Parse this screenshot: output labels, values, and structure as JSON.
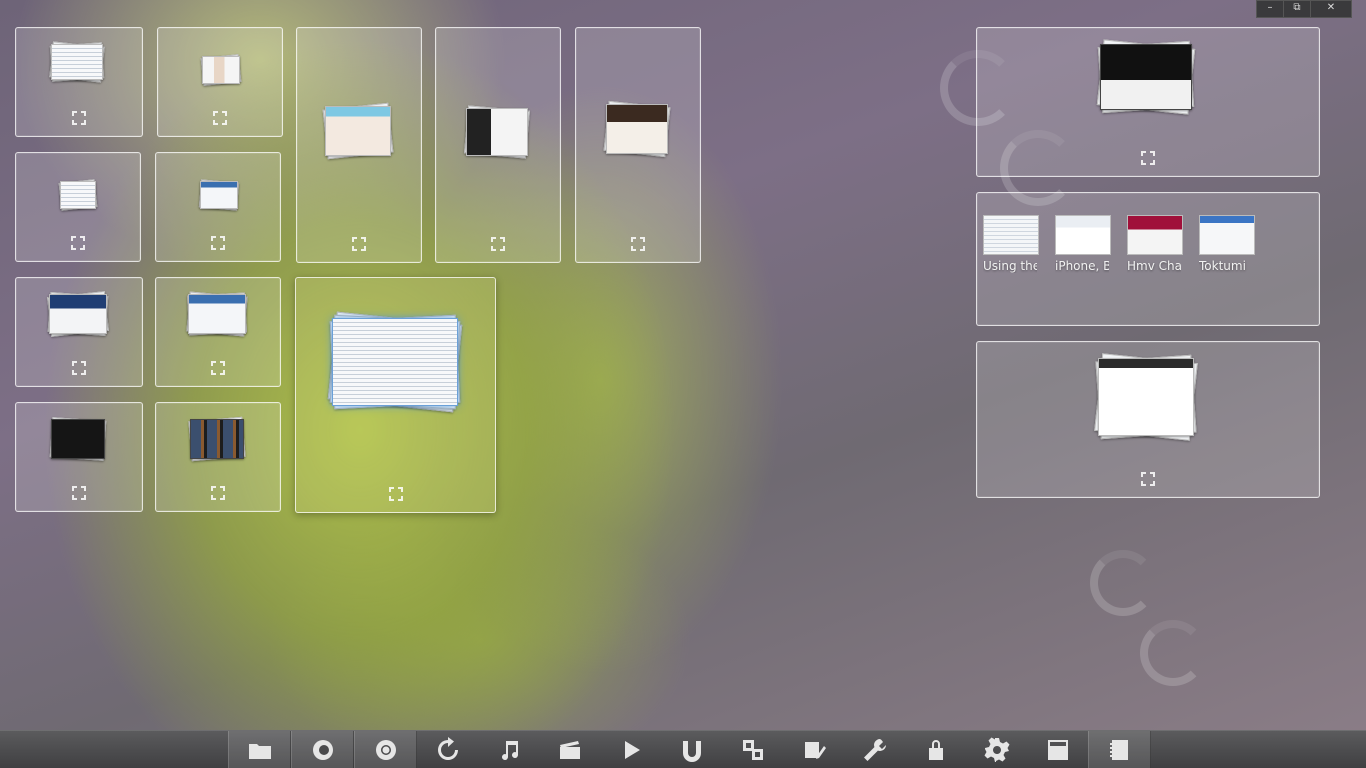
{
  "window_controls": {
    "minimize": "–",
    "restore": "⧉",
    "close": "✕"
  },
  "right_panel": {
    "thumbnails": [
      {
        "caption": "Using the"
      },
      {
        "caption": "iPhone, B"
      },
      {
        "caption": "Hmv Cha"
      },
      {
        "caption": "Toktumi"
      }
    ]
  },
  "taskbar": {
    "icons": [
      "folder-icon",
      "firefox-icon",
      "chrome-icon",
      "refresh-icon",
      "music-note-icon",
      "clapperboard-icon",
      "play-icon",
      "utorrent-icon",
      "windows-switch-icon",
      "notepad-icon",
      "wrench-icon",
      "lock-icon",
      "gear-icon",
      "calculator-icon",
      "notes-icon"
    ]
  }
}
